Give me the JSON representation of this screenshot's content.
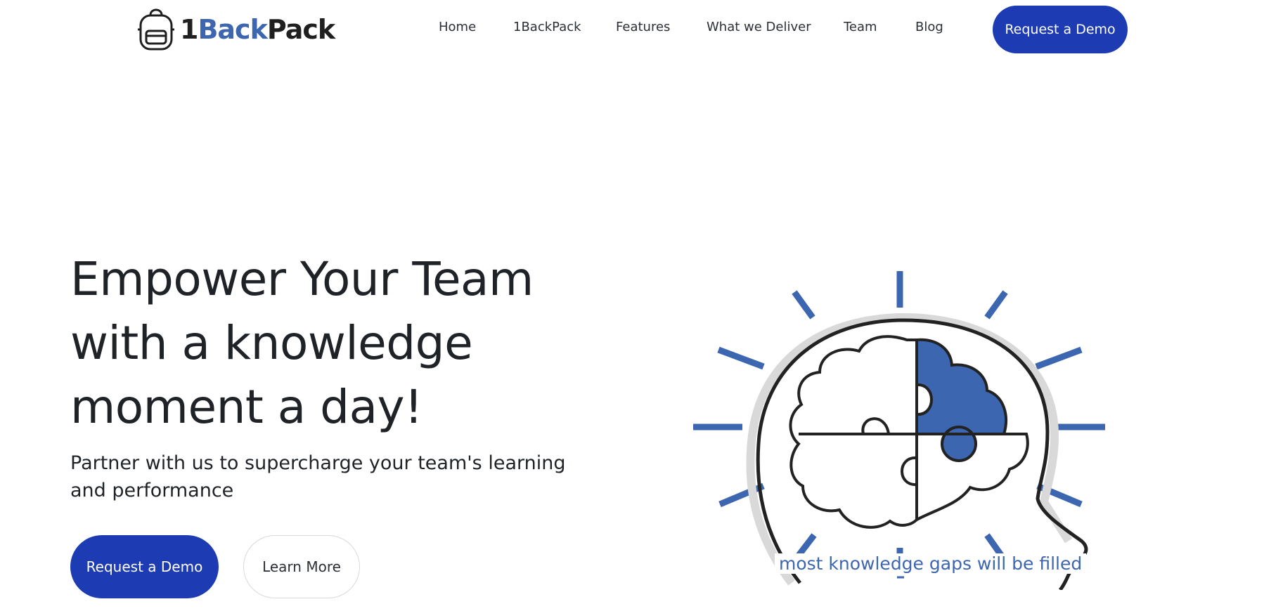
{
  "header": {
    "logo": {
      "text_1": "1",
      "text_2": "Back",
      "text_3": "Pack",
      "icon": "backpack-icon"
    },
    "nav": [
      {
        "label": "Home"
      },
      {
        "label": "1BackPack"
      },
      {
        "label": "Features"
      },
      {
        "label": "What we Deliver"
      },
      {
        "label": "Team"
      },
      {
        "label": "Blog"
      }
    ],
    "cta_label": "Request a Demo"
  },
  "hero": {
    "title": "Empower Your Team with a knowledge moment a day!",
    "subtitle": "Partner with us to supercharge your team's learning and performance",
    "primary_label": "Request a Demo",
    "secondary_label": "Learn More",
    "illustration_caption": "most knowledge gaps will be filled"
  },
  "colors": {
    "primary": "#1d3bb3",
    "accent_blue": "#3d66b0",
    "text": "#1f2328"
  }
}
